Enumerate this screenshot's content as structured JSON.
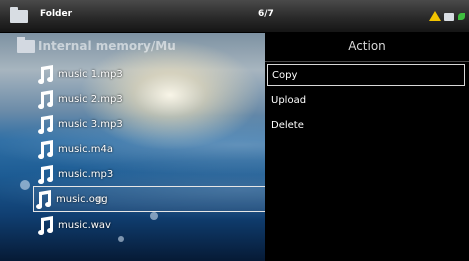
{
  "topbar": {
    "title": "Folder",
    "counter": "6/7"
  },
  "path": {
    "label": "Internal memory/Mu"
  },
  "files": [
    {
      "name": "music 1.mp3"
    },
    {
      "name": "music 2.mp3"
    },
    {
      "name": "music 3.mp3"
    },
    {
      "name": "music.m4a"
    },
    {
      "name": "music.mp3"
    },
    {
      "name": "music.ogg",
      "selected": true
    },
    {
      "name": "music.wav"
    }
  ],
  "action_menu": {
    "title": "Action",
    "items": [
      {
        "label": "Copy",
        "active": true
      },
      {
        "label": "Upload"
      },
      {
        "label": "Delete"
      }
    ]
  },
  "icons": {
    "topbar_folder": "folder-icon",
    "warning": "warning-icon",
    "storage": "folder-icon",
    "battery": "leaf-icon",
    "file": "music-note-icon"
  },
  "colors": {
    "warning": "#f2c400",
    "status_green": "#3fbf3f"
  }
}
